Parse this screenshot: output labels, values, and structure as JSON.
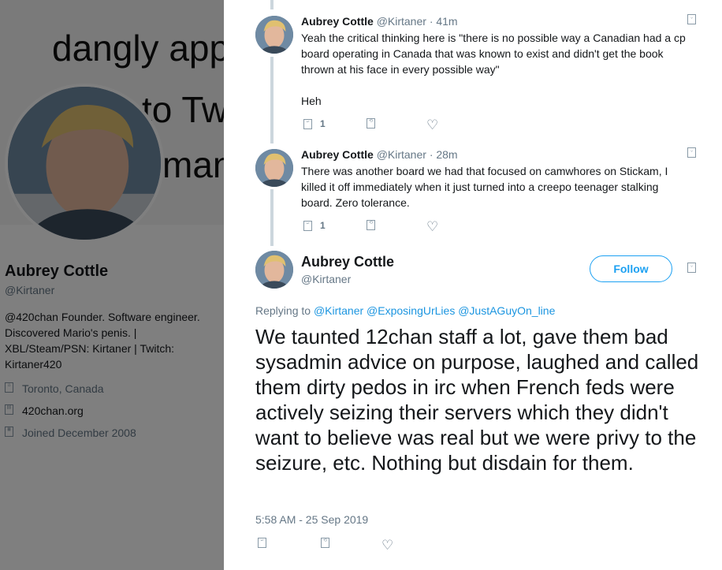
{
  "profile": {
    "banner_lines": [
      "dangly app",
      "to Tw",
      "man"
    ],
    "name": "Aubrey Cottle",
    "handle": "@Kirtaner",
    "bio": "@420chan Founder. Software engineer. Discovered Mario's penis. | XBL/Steam/PSN: Kirtaner | Twitch: Kirtaner420",
    "location": "Toronto, Canada",
    "website": "420chan.org",
    "joined": "Joined December 2008",
    "location_icon": "location-icon",
    "website_icon": "link-icon",
    "joined_icon": "calendar-icon"
  },
  "thread": [
    {
      "name": "Aubrey Cottle",
      "handle": "@Kirtaner",
      "time": "· 41m",
      "text": "Yeah the critical thinking here is \"there is no possible way a Canadian had a cp board operating in Canada that was known to exist and didn't get the book thrown at his face in every possible way\"",
      "text2": "Heh",
      "reply_count": "1"
    },
    {
      "name": "Aubrey Cottle",
      "handle": "@Kirtaner",
      "time": "· 28m",
      "text": "There was another board we had that focused on camwhores on Stickam, I killed it off immediately when it just turned into a creepo teenager stalking board. Zero tolerance.",
      "reply_count": "1"
    }
  ],
  "main_tweet": {
    "name": "Aubrey Cottle",
    "handle": "@Kirtaner",
    "follow_label": "Follow",
    "replying_prefix": "Replying to",
    "replying_mentions": "@Kirtaner @ExposingUrLies @JustAGuyOn_line",
    "text": "We taunted 12chan staff a lot, gave them bad sysadmin advice on purpose, laughed and called them dirty pedos in irc when French feds were actively seizing their servers which they didn't want to believe was real but we were privy to the seizure, etc. Nothing but disdain for them.",
    "timestamp": "5:58 AM - 25 Sep 2019"
  },
  "icons": {
    "reply": "reply-icon",
    "retweet": "retweet-icon",
    "like": "heart-icon",
    "caret": "chevron-down-icon",
    "heart_glyph": "♡",
    "missing_glyph": "▯"
  },
  "colors": {
    "link": "#1b95e0",
    "follow": "#1da1f2",
    "secondary_text": "#657786",
    "thread_line": "#ccd6dd"
  }
}
